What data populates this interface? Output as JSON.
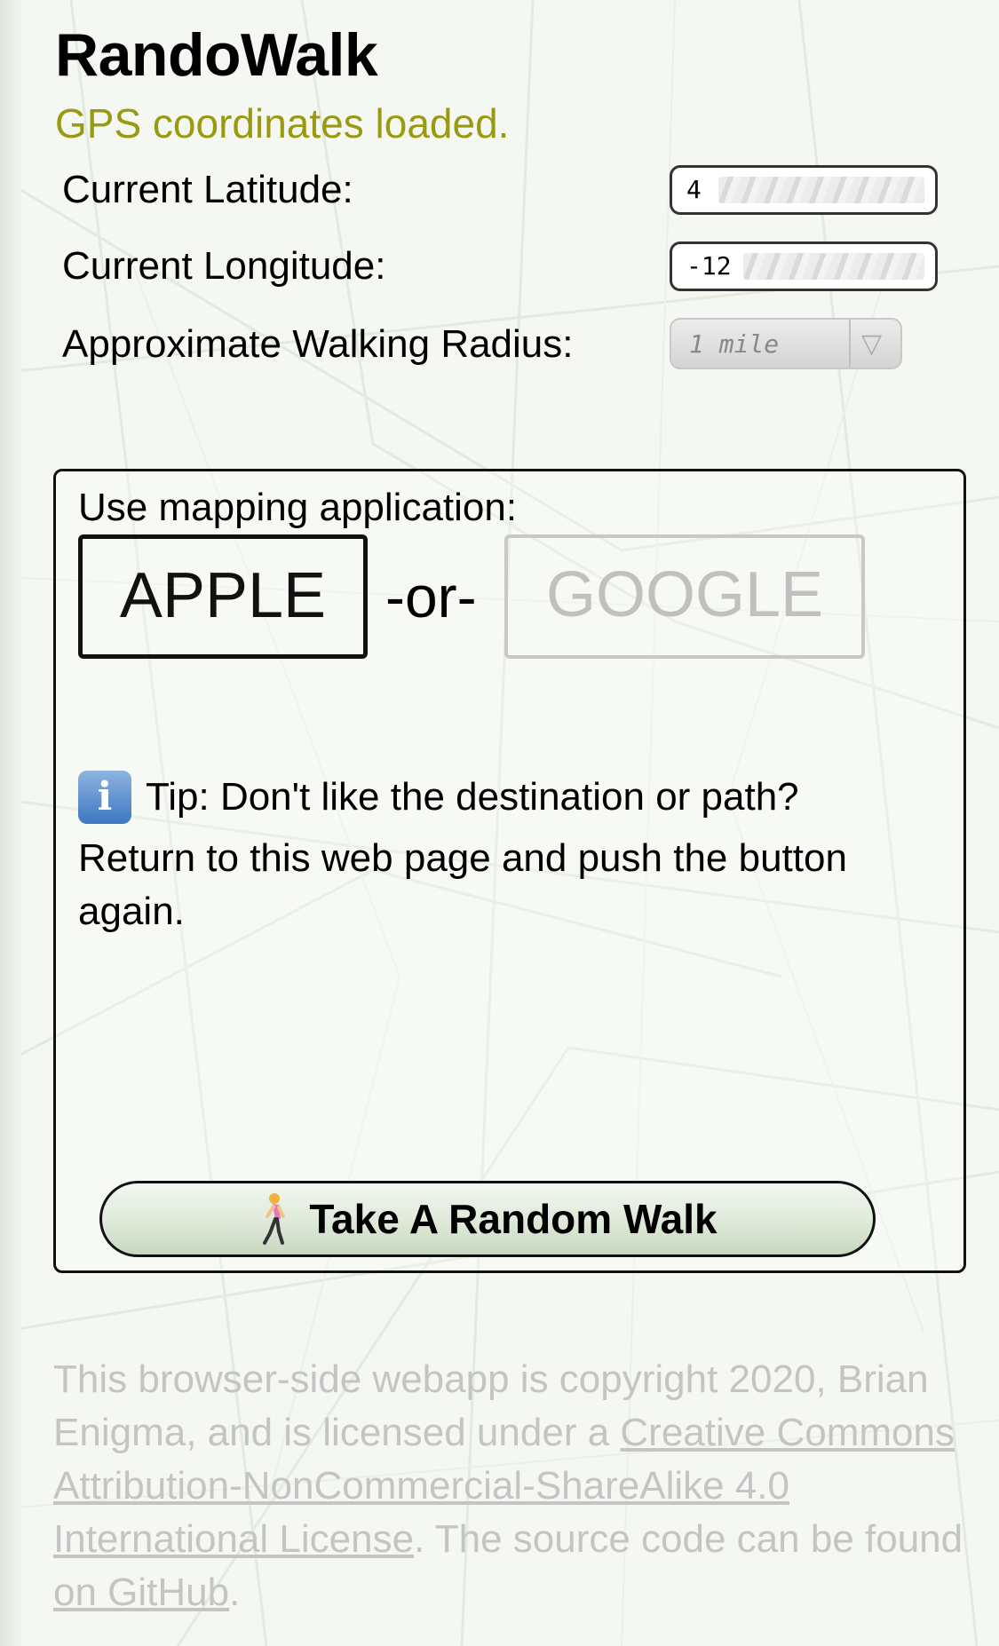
{
  "app": {
    "title": "RandoWalk",
    "status": "GPS coordinates loaded."
  },
  "colors": {
    "status": "#9a9a10",
    "footer_text": "#c4c4c4",
    "walk_button_fill": "#dbe7d5"
  },
  "fields": {
    "latitude": {
      "label": "Current Latitude:",
      "value": "4"
    },
    "longitude": {
      "label": "Current Longitude:",
      "value": "-12"
    },
    "radius": {
      "label": "Approximate Walking Radius:",
      "value": "1 mile",
      "icon": "triangle-down-icon"
    }
  },
  "mapping": {
    "label": "Use mapping application:",
    "apple": "APPLE",
    "or": "-or-",
    "google": "GOOGLE",
    "selected": "APPLE"
  },
  "tip": {
    "icon": "info-icon",
    "icon_glyph": "i",
    "line1": "Tip: Don't like the destination or path?",
    "rest": "Return to this web page and push the button again."
  },
  "walk_button": {
    "label": "Take A Random Walk",
    "icon": "person-walking-icon"
  },
  "footer": {
    "text1": "This browser-side webapp is copyright 2020, Brian Enigma, and is licensed under a ",
    "license_link": "Creative Commons Attribution-NonCommercial-ShareAlike 4.0 International License",
    "text2": ". The source code can be found ",
    "github_link": "on GitHub",
    "text3": "."
  }
}
